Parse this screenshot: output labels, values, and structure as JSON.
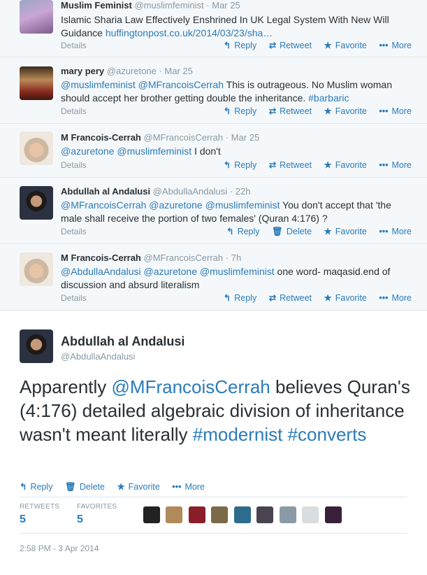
{
  "tweets": [
    {
      "name": "Muslim Feminist",
      "handle": "@muslimfeminist",
      "time": "Mar 25",
      "text": "Islamic Sharia Law Effectively Enshrined In UK Legal System With New Will Guidance ",
      "link": "huffingtonpost.co.uk/2014/03/23/sha…",
      "details": "Details",
      "actions": [
        "Reply",
        "Retweet",
        "Favorite",
        "More"
      ]
    },
    {
      "name": "mary pery",
      "handle": "@azuretone",
      "time": "Mar 25",
      "mentions": "@muslimfeminist @MFrancoisCerrah",
      "text": " This is outrageous. No Muslim woman should accept her brother getting double the inheritance. ",
      "hashtag": "#barbaric",
      "details": "Details",
      "actions": [
        "Reply",
        "Retweet",
        "Favorite",
        "More"
      ]
    },
    {
      "name": "M Francois-Cerrah",
      "handle": "@MFrancoisCerrah",
      "time": "Mar 25",
      "mentions": "@azuretone @muslimfeminist",
      "text": " I don't",
      "details": "Details",
      "actions": [
        "Reply",
        "Retweet",
        "Favorite",
        "More"
      ]
    },
    {
      "name": "Abdullah al Andalusi",
      "handle": "@AbdullaAndalusi",
      "time": "22h",
      "mentions": "@MFrancoisCerrah @azuretone @muslimfeminist",
      "text": " You don't accept that 'the male shall receive the portion of two females' (Quran 4:176) ?",
      "details": "Details",
      "actions": [
        "Reply",
        "Delete",
        "Favorite",
        "More"
      ]
    },
    {
      "name": "M Francois-Cerrah",
      "handle": "@MFrancoisCerrah",
      "time": "7h",
      "mentions": "@AbdullaAndalusi @azuretone @muslimfeminist",
      "text": " one word- maqasid.end of discussion and absurd literalism",
      "details": "Details",
      "actions": [
        "Reply",
        "Retweet",
        "Favorite",
        "More"
      ]
    }
  ],
  "main": {
    "name": "Abdullah al Andalusi",
    "handle": "@AbdullaAndalusi",
    "text_1": "Apparently ",
    "mention": "@MFrancoisCerrah",
    "text_2": " believes Quran's (4:176) detailed algebraic division of inheritance wasn't meant literally ",
    "hashtag_1": "#modernist",
    "hashtag_2": "#converts",
    "actions": [
      "Reply",
      "Delete",
      "Favorite",
      "More"
    ],
    "retweets_label": "RETWEETS",
    "retweets": "5",
    "favorites_label": "FAVORITES",
    "favorites": "5",
    "timestamp": "2:58 PM - 3 Apr 2014"
  },
  "icons": {
    "reply": "reply-icon",
    "retweet": "retweet-icon",
    "delete": "trash-icon",
    "favorite": "star-icon",
    "more": "more-icon"
  },
  "colors": {
    "link": "#2b7bb9",
    "muted": "#8899a6",
    "text": "#292f33"
  }
}
